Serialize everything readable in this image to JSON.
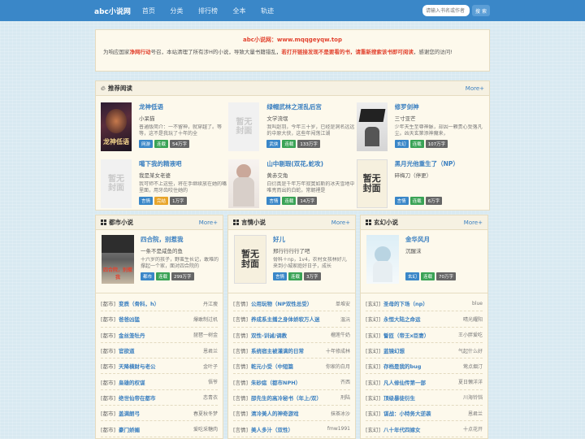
{
  "header": {
    "logo": "abc小说网",
    "nav": [
      "首页",
      "分类",
      "排行榜",
      "全本",
      "轨迹"
    ],
    "search_placeholder": "请输入书名或作者",
    "search_button": "搜 索"
  },
  "notice": {
    "site": "abc小说网：www.mqqgeyqw.top",
    "msg_1": "为响应国家",
    "msg_2": "净网行动",
    "msg_3": "号召，本站清理了所有涉H的小说，导致大量书籍错乱，",
    "msg_4": "若打开链接发现不是要看的书，请重新搜索该书即可阅读",
    "msg_5": "，感谢您的访问!"
  },
  "recommend": {
    "title": "推荐阅读",
    "more": "More+",
    "books": [
      {
        "title": "龙神低语",
        "author": "小呆猫",
        "desc": "普通版简介：一不留神，就穿越了。等等，这不是我玩了十年的全",
        "tags": [
          "网游",
          "连载",
          "54万字"
        ],
        "cover": "dark"
      },
      {
        "title": "绿帽武林之淫乱后宫",
        "author": "文学流氓",
        "desc": "我叫赵羽，今年三十岁，已经是洞名远远的中原大侠，这些年闯荡江湖",
        "tags": [
          "武侠",
          "连载",
          "133万字"
        ],
        "cover": "none"
      },
      {
        "title": "修罗剑神",
        "author": "三寸亚芒",
        "desc": "少年天生至尊神脉，却因一颗贵心受落凡尘。凶天玄第添神魔来，",
        "tags": [
          "玄幻",
          "连载",
          "107万字"
        ],
        "cover": "ink"
      },
      {
        "title": "噶下我的精液吧",
        "author": "我是某女老婆",
        "desc": "我可师不上这些，将在手继续放在她的嘴里面，用牙齿咬住她的",
        "tags": [
          "言情",
          "完结",
          "1万字"
        ],
        "cover": "none"
      },
      {
        "title": "山中剔瑕(双花,蛇攻)",
        "author": "黄赤交角",
        "desc": "白衍真是千年万年寂寞如斯的冰天雪地中唯亮而出的白蛇。常朝裡是",
        "tags": [
          "言情",
          "连载",
          "14万字"
        ],
        "cover": "girl"
      },
      {
        "title": "黑月光他重生了（NP）",
        "author": "碎梅刀（停更）",
        "desc": "",
        "tags": [
          "言情",
          "连载",
          "6万字"
        ],
        "cover": "none2"
      }
    ]
  },
  "columns": [
    {
      "title": "都市小说",
      "more": "More+",
      "feat": {
        "title": "四合院，别惹我",
        "author": "一条不是咸鱼的鱼",
        "desc": "十六岁的孩子，野蛮生长记，敢难的撑起一个家，面对四合院的",
        "tags": [
          "都市",
          "连载",
          "299万字"
        ]
      },
      "items": [
        {
          "cat": "[都市]",
          "name": "变质（骨科，h）",
          "author": "丹江瘦"
        },
        {
          "cat": "[都市]",
          "name": "爸爸凶猛",
          "author": "爆敢制过机"
        },
        {
          "cat": "[都市]",
          "name": "金丝笼牡丹",
          "author": "琵琶一树金"
        },
        {
          "cat": "[都市]",
          "name": "官欲道",
          "author": "恩君兰"
        },
        {
          "cat": "[都市]",
          "name": "天降横财与老公",
          "author": "金叶子"
        },
        {
          "cat": "[都市]",
          "name": "枭雄的权谋",
          "author": "悟爷"
        },
        {
          "cat": "[都市]",
          "name": "绝世仙帝在都市",
          "author": "恋青衣"
        },
        {
          "cat": "[都市]",
          "name": "盖满朗弓",
          "author": "春夏秋冬梦"
        },
        {
          "cat": "[都市]",
          "name": "豪门娇媚",
          "author": "爱吃采糖肉"
        }
      ]
    },
    {
      "title": "言情小说",
      "more": "More+",
      "feat": {
        "title": "好儿",
        "author": "邢行行行行了吧",
        "desc": "骨科＋np，1v4，农村女孩林好儿来到小城家庭好日子，成长",
        "tags": [
          "言情",
          "连载",
          "3万字"
        ]
      },
      "items": [
        {
          "cat": "[言情]",
          "name": "公用玩物（NP双性总受）",
          "author": "单堆安"
        },
        {
          "cat": "[言情]",
          "name": "养成系主播之身体娇软万人迷",
          "author": "温沅"
        },
        {
          "cat": "[言情]",
          "name": "双性-训诫/调教",
          "author": "榴莲牛奶"
        },
        {
          "cat": "[言情]",
          "name": "系统宿主被灌满的日常",
          "author": "十年修成林"
        },
        {
          "cat": "[言情]",
          "name": "乾元小受（中短篇",
          "author": "你家的白月"
        },
        {
          "cat": "[言情]",
          "name": "朱砂痣（都市NPH）",
          "author": "齐西"
        },
        {
          "cat": "[言情]",
          "name": "邵先生的高冷秘书（年上/双）",
          "author": "刑陆"
        },
        {
          "cat": "[言情]",
          "name": "清冷美人的神奇游戏",
          "author": "抹茶冰沙"
        },
        {
          "cat": "[言情]",
          "name": "美人多汁（双性）",
          "author": "fmw1991"
        }
      ]
    },
    {
      "title": "玄幻小说",
      "more": "More+",
      "feat": {
        "title": "金华风月",
        "author": "沉醒沫",
        "desc": "",
        "tags": [
          "玄幻",
          "连载",
          "70万字"
        ]
      },
      "items": [
        {
          "cat": "[玄幻]",
          "name": "圣母的下场（np）",
          "author": "blue"
        },
        {
          "cat": "[玄幻]",
          "name": "永恒大陆之命运",
          "author": "晴光耀阳"
        },
        {
          "cat": "[玄幻]",
          "name": "誓匝（帝王x臣妻）",
          "author": "王小胖爱吃"
        },
        {
          "cat": "[玄幻]",
          "name": "蓝镜幻想",
          "author": "气起什么好"
        },
        {
          "cat": "[玄幻]",
          "name": "存档是我的bug",
          "author": "莺点烟汀"
        },
        {
          "cat": "[玄幻]",
          "name": "凡人修仙传第一部",
          "author": "夏日懒洋洋"
        },
        {
          "cat": "[玄幻]",
          "name": "顶级暴徒衍生",
          "author": "川海铃铛"
        },
        {
          "cat": "[玄幻]",
          "name": "谋战：小特务大逆袭",
          "author": "恩君兰"
        },
        {
          "cat": "[玄幻]",
          "name": "八十年代四嫁女",
          "author": "十点花开"
        }
      ]
    }
  ],
  "nocover_text": "暂无封面",
  "colors": {
    "topbar": "#3a87c8",
    "link": "#3a7fc0",
    "red": "#e2432f",
    "panel": "#fdf9ec"
  }
}
